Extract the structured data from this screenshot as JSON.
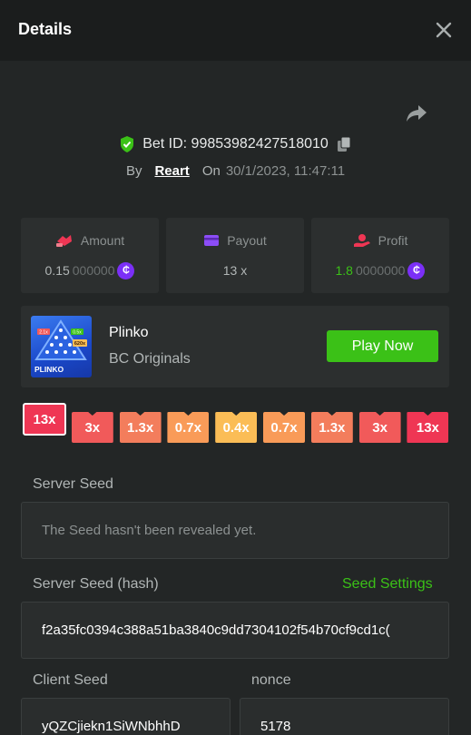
{
  "header": {
    "title": "Details",
    "close_icon": "close-icon"
  },
  "bet": {
    "id_label": "Bet ID: 99853982427518010",
    "by_label": "By",
    "user": "Reart",
    "on_label": "On",
    "date": "30/1/2023, 11:47:11"
  },
  "stats": {
    "amount": {
      "label": "Amount",
      "value_main": "0.15",
      "value_dim": "000000"
    },
    "payout": {
      "label": "Payout",
      "value": "13 x"
    },
    "profit": {
      "label": "Profit",
      "value_main": "1.8",
      "value_dim": "0000000"
    }
  },
  "game": {
    "name": "Plinko",
    "provider": "BC Originals",
    "play_label": "Play Now",
    "thumb_text": "PLINKO",
    "thumb_chip_1": "2.1x",
    "thumb_chip_2": "0.5x",
    "thumb_chip_3": "620x"
  },
  "multipliers": [
    {
      "label": "13x",
      "color": "#ef3654",
      "active": true
    },
    {
      "label": "3x",
      "color": "#f15a5a",
      "active": false
    },
    {
      "label": "1.3x",
      "color": "#f37d5c",
      "active": false
    },
    {
      "label": "0.7x",
      "color": "#f99b58",
      "active": false
    },
    {
      "label": "0.4x",
      "color": "#fbbd56",
      "active": false
    },
    {
      "label": "0.7x",
      "color": "#f99b58",
      "active": false
    },
    {
      "label": "1.3x",
      "color": "#f37d5c",
      "active": false
    },
    {
      "label": "3x",
      "color": "#f15a5a",
      "active": false
    },
    {
      "label": "13x",
      "color": "#ef3654",
      "active": false
    }
  ],
  "seeds": {
    "server_seed_label": "Server Seed",
    "server_seed_value": "The Seed hasn't been revealed yet.",
    "server_hash_label": "Server Seed (hash)",
    "seed_settings_label": "Seed Settings",
    "server_hash_value": "f2a35fc0394c388a51ba3840c9dd7304102f54b70cf9cd1c(",
    "client_seed_label": "Client Seed",
    "client_seed_value": "yQZCjiekn1SiWNbhhD",
    "nonce_label": "nonce",
    "nonce_value": "5178"
  },
  "colors": {
    "accent_green": "#3bc117",
    "coin_purple": "#7b2ff7",
    "shield_green": "#3bc117"
  }
}
